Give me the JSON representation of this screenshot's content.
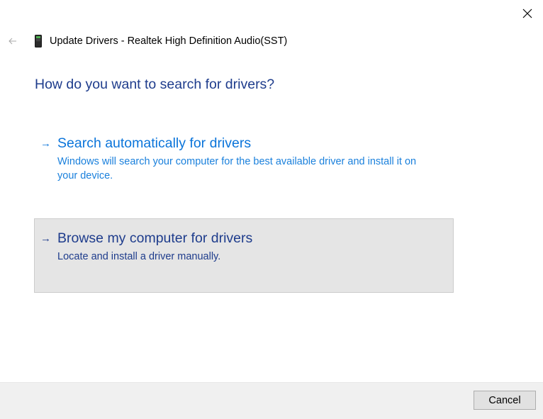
{
  "window": {
    "title": "Update Drivers - Realtek High Definition Audio(SST)",
    "back_icon": "back-arrow-icon",
    "close_icon": "close-icon",
    "device_icon": "audio-device-icon"
  },
  "main": {
    "heading": "How do you want to search for drivers?",
    "options": [
      {
        "arrow": "→",
        "title": "Search automatically for drivers",
        "description": "Windows will search your computer for the best available driver and install it on your device.",
        "color": "#0a74da"
      },
      {
        "arrow": "→",
        "title": "Browse my computer for drivers",
        "description": "Locate and install a driver manually.",
        "color": "#1e3c8c",
        "highlighted": true
      }
    ]
  },
  "footer": {
    "cancel_label": "Cancel"
  },
  "colors": {
    "heading": "#1e3c8c",
    "link": "#0a74da",
    "hover_bg": "#e5e5e5",
    "footer_bg": "#f0f0f0"
  }
}
